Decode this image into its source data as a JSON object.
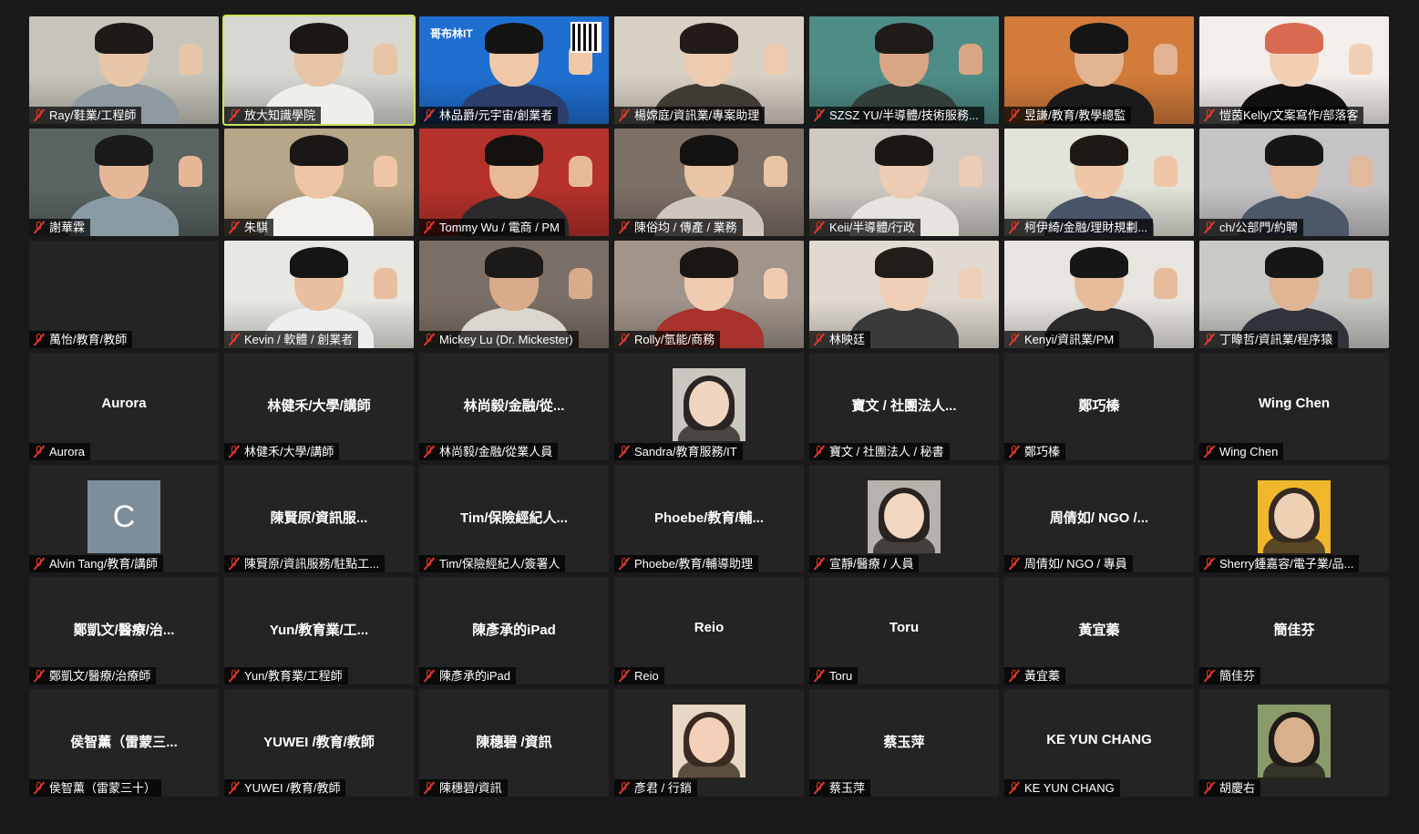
{
  "meeting": {
    "participants": [
      {
        "label": "Ray/鞋業/工程師",
        "video": true,
        "bg": "#c7c5bb",
        "skin": "#e8c6a8",
        "hair": "#1e1a18",
        "shirt": "#8f9aa0"
      },
      {
        "label": "放大知識學院",
        "video": true,
        "active": true,
        "bg": "#d8d8d2",
        "skin": "#e6c4a5",
        "hair": "#1a1714",
        "shirt": "#eeeeea"
      },
      {
        "label": "林品爵/元宇宙/創業者",
        "video": true,
        "bg": "#1f6fd0",
        "skin": "#f0c8a8",
        "hair": "#141414",
        "shirt": "#2c3e6a",
        "overlay": "哥布林IT"
      },
      {
        "label": "楊嫦庭/資訊業/專案助理",
        "video": true,
        "bg": "#d9d0c4",
        "skin": "#eccbb0",
        "hair": "#231b17",
        "shirt": "#403a34"
      },
      {
        "label": "SZSZ YU/半導體/技術服務...",
        "video": true,
        "bg": "#4e8c86",
        "skin": "#d9a684",
        "hair": "#1f1b19",
        "shirt": "#333d3a"
      },
      {
        "label": "昱謙/教育/教學總監",
        "video": true,
        "bg": "#d27b3a",
        "skin": "#e2b391",
        "hair": "#151515",
        "shirt": "#1a1a1a"
      },
      {
        "label": "愷茵Kelly/文案寫作/部落客",
        "video": true,
        "bg": "#f3eeea",
        "skin": "#f1cfb5",
        "hair": "#d86a52",
        "shirt": "#111111"
      },
      {
        "label": "謝華霖",
        "video": true,
        "bg": "#5a6462",
        "skin": "#e6b797",
        "hair": "#1a1a1a",
        "shirt": "#8a9ba4"
      },
      {
        "label": "朱騏",
        "video": true,
        "bg": "#b8a688",
        "skin": "#eec6a6",
        "hair": "#1a1716",
        "shirt": "#f3f1ee"
      },
      {
        "label": "Tommy Wu / 電商 / PM",
        "video": true,
        "bg": "#b5312b",
        "skin": "#e8b995",
        "hair": "#14110f",
        "shirt": "#2b2b2b"
      },
      {
        "label": "陳俗均 / 傳產 / 業務",
        "video": true,
        "bg": "#7c6f66",
        "skin": "#e9c4a5",
        "hair": "#151312",
        "shirt": "#cfc7bf"
      },
      {
        "label": "Keii/半導體/行政",
        "video": true,
        "bg": "#cdc8c2",
        "skin": "#eccdb4",
        "hair": "#1b1715",
        "shirt": "#e7e3de"
      },
      {
        "label": "柯伊綺/金融/理財規劃...",
        "video": true,
        "bg": "#e2e3d9",
        "skin": "#efc7a6",
        "hair": "#1f1916",
        "shirt": "#4a556a"
      },
      {
        "label": "ch/公部門/約聘",
        "video": true,
        "bg": "#c5c3c6",
        "skin": "#e2b99a",
        "hair": "#161616",
        "shirt": "#4c5868"
      },
      {
        "label": "萬怡/教育/教師",
        "video": false
      },
      {
        "label": "Kevin / 軟體 / 創業者",
        "video": true,
        "bg": "#e9e7e1",
        "skin": "#e8c0a0",
        "hair": "#151515",
        "shirt": "#eeeeee"
      },
      {
        "label": "Mickey Lu (Dr. Mickester)",
        "video": true,
        "bg": "#7a6f66",
        "skin": "#d9ab8a",
        "hair": "#1c1a18",
        "shirt": "#dad6d0"
      },
      {
        "label": "Rolly/氫能/商務",
        "video": true,
        "bg": "#a1948a",
        "skin": "#f0cbb0",
        "hair": "#1a1614",
        "shirt": "#a8322c"
      },
      {
        "label": "林映廷",
        "video": true,
        "bg": "#e0dad1",
        "skin": "#efcfb6",
        "hair": "#231d1a",
        "shirt": "#3a3a3a"
      },
      {
        "label": "Kenyi/資訊業/PM",
        "video": true,
        "bg": "#e8e5e1",
        "skin": "#e7bc9b",
        "hair": "#161616",
        "shirt": "#2a2a2a"
      },
      {
        "label": "丁暐哲/資訊業/程序猿",
        "video": true,
        "bg": "#c9c9c6",
        "skin": "#e0b594",
        "hair": "#161616",
        "shirt": "#30343a"
      },
      {
        "label": "Aurora",
        "center": "Aurora",
        "video": false
      },
      {
        "label": "林健禾/大學/講師",
        "center": "林健禾/大學/講師",
        "video": false
      },
      {
        "label": "林尚毅/金融/從業人員",
        "center": "林尚毅/金融/從...",
        "video": false
      },
      {
        "label": "Sandra/教育服務/IT",
        "video": false,
        "avatar": "photo",
        "abg": "#c9c7c0",
        "askin": "#f0d6c1",
        "ahair": "#2a2522"
      },
      {
        "label": "寶文 / 社團法人 / 秘書",
        "center": "寶文 / 社團法人...",
        "video": false
      },
      {
        "label": "鄭巧榛",
        "center": "鄭巧榛",
        "video": false
      },
      {
        "label": "Wing Chen",
        "center": "Wing Chen",
        "video": false
      },
      {
        "label": "Alvin Tang/教育/講師",
        "video": false,
        "avatar": "letter",
        "letter": "C"
      },
      {
        "label": "陳賢原/資訊服務/駐點工...",
        "center": "陳賢原/資訊服...",
        "video": false
      },
      {
        "label": "Tim/保險經紀人/簽署人",
        "center": "Tim/保險經紀人...",
        "video": false
      },
      {
        "label": "Phoebe/教育/輔導助理",
        "center": "Phoebe/教育/輔...",
        "video": false
      },
      {
        "label": "宣靜/醫療 / 人員",
        "video": false,
        "avatar": "photo",
        "abg": "#b6b3ac",
        "askin": "#f2d7c2",
        "ahair": "#2a2320"
      },
      {
        "label": "周倩如/ NGO / 專員",
        "center": "周倩如/ NGO /...",
        "video": false
      },
      {
        "label": "Sherry鍾嘉容/電子業/品...",
        "video": false,
        "avatar": "photo",
        "abg": "#f0b72c",
        "askin": "#eed0b5",
        "ahair": "#342a22"
      },
      {
        "label": "鄭凱文/醫療/治療師",
        "center": "鄭凱文/醫療/治...",
        "video": false
      },
      {
        "label": "Yun/教育業/工程師",
        "center": "Yun/教育業/工...",
        "video": false
      },
      {
        "label": "陳彥承的iPad",
        "center": "陳彥承的iPad",
        "video": false
      },
      {
        "label": "Reio",
        "center": "Reio",
        "video": false
      },
      {
        "label": "Toru",
        "center": "Toru",
        "video": false
      },
      {
        "label": "黃宜蓁",
        "center": "黃宜蓁",
        "video": false
      },
      {
        "label": "簡佳芬",
        "center": "簡佳芬",
        "video": false
      },
      {
        "label": "侯智薰（雷蒙三十）",
        "center": "侯智薰（雷蒙三...",
        "video": false
      },
      {
        "label": "YUWEI /教育/教師",
        "center": "YUWEI /教育/教師",
        "video": false
      },
      {
        "label": "陳穗碧/資訊",
        "center": "陳穗碧 /資訊",
        "video": false
      },
      {
        "label": "彥君 / 行銷",
        "video": false,
        "avatar": "photo",
        "abg": "#e7d7c4",
        "askin": "#f2d1b8",
        "ahair": "#3a2a20"
      },
      {
        "label": "蔡玉萍",
        "center": "蔡玉萍",
        "video": false
      },
      {
        "label": "KE YUN CHANG",
        "center": "KE YUN CHANG",
        "video": false
      },
      {
        "label": "胡慶右",
        "video": false,
        "avatar": "photo",
        "abg": "#8a9a6a",
        "askin": "#d9b08e",
        "ahair": "#1e1b18"
      }
    ]
  }
}
